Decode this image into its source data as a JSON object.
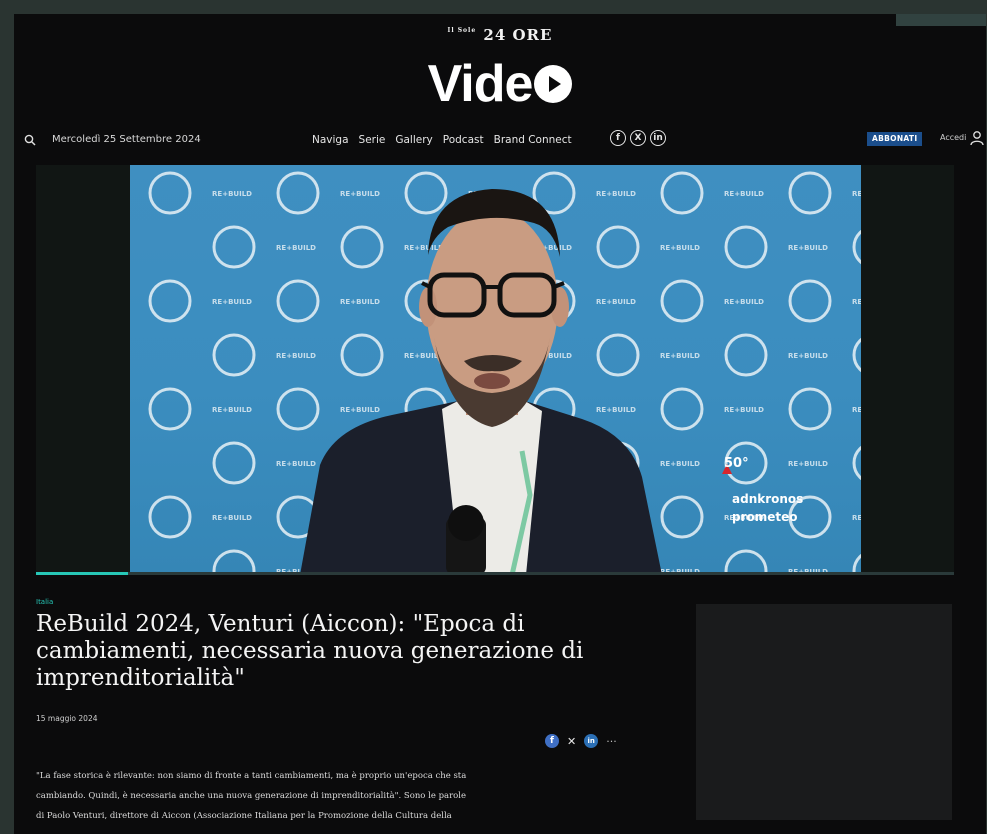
{
  "brand": {
    "pre": "Il Sole",
    "logo": "24 ORE",
    "section_prefix": "Vide",
    "section_icon": "play-circle-icon"
  },
  "nav": {
    "search_icon": "search-icon",
    "date": "Mercoledì 25 Settembre 2024",
    "links": [
      "Naviga",
      "Serie",
      "Gallery",
      "Podcast",
      "Brand Connect"
    ],
    "social": [
      "f",
      "X",
      "in"
    ],
    "subscribe_label": "ABBONATI",
    "login_label": "Accedi",
    "user_icon": "user-icon"
  },
  "video": {
    "progress": 0.1,
    "backdrop_brand": "RE+BUILD",
    "watermark": {
      "number": "50°",
      "line1": "adnkronos",
      "line2": "prometeo"
    }
  },
  "article": {
    "category": "Italia",
    "title": "ReBuild 2024, Venturi (Aiccon): \"Epoca di cambiamenti, necessaria nuova generazione di imprenditorialità\"",
    "date": "15 maggio 2024",
    "share": {
      "facebook": "f",
      "x": "✕",
      "linkedin": "in",
      "more": "···"
    },
    "body_lines": [
      "\"La fase storica è rilevante: non siamo di fronte a tanti cambiamenti, ma è proprio un'epoca che sta",
      "cambiando. Quindi, è necessaria anche una nuova generazione di imprenditorialità\". Sono le parole",
      "di Paolo Venturi, direttore di Aiccon (Associazione Italiana per la Promozione della Cultura della"
    ]
  },
  "colors": {
    "accent": "#27c7b7",
    "subscribe": "#1b4e8c",
    "background": "#0b0b0c",
    "video_backdrop": "#3b8dbf"
  }
}
